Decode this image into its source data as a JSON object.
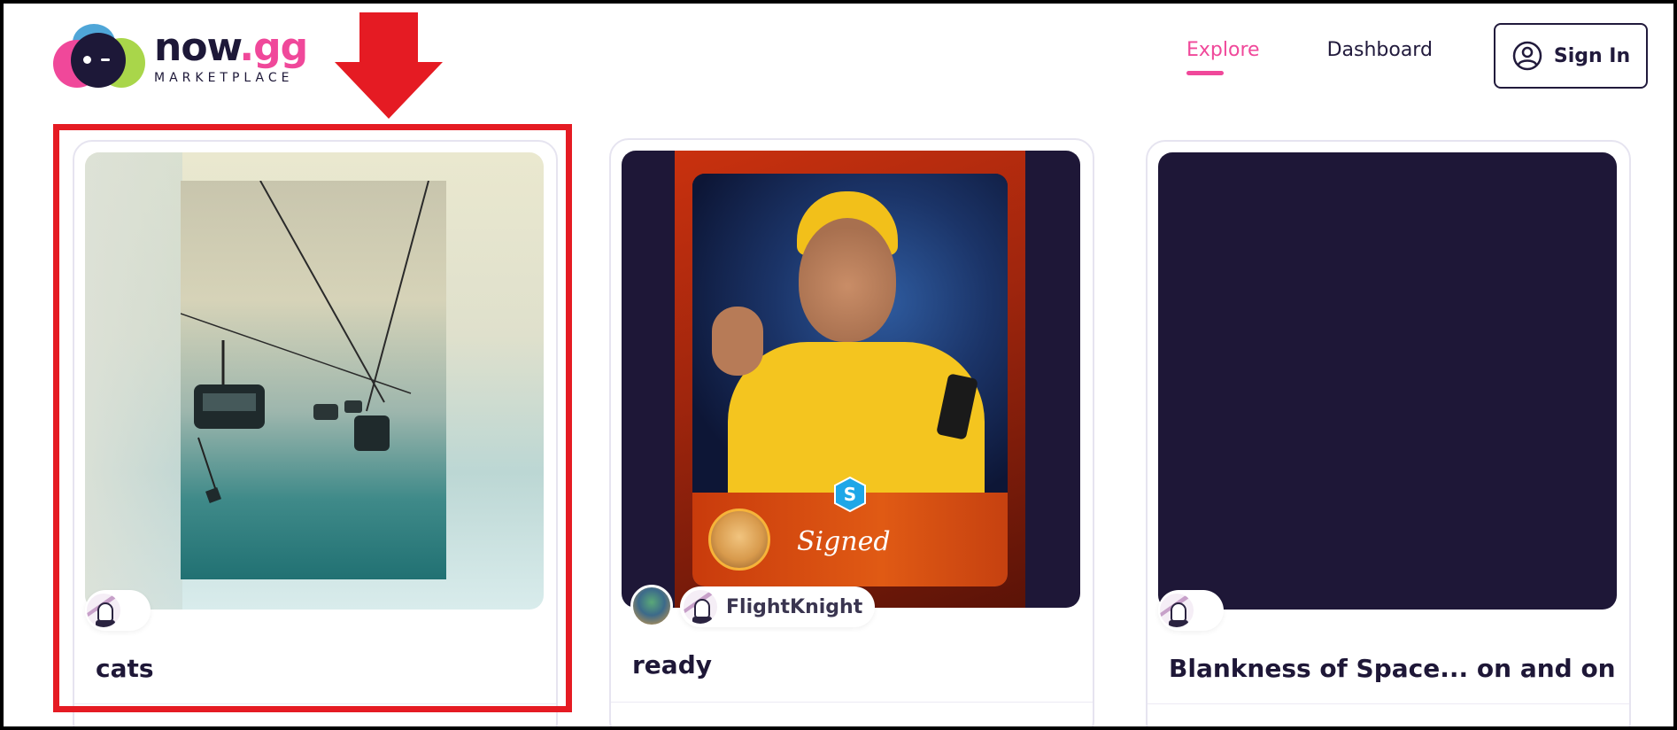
{
  "header": {
    "logo": {
      "wordmark_main": "now",
      "wordmark_accent": ".gg",
      "tagline": "MARKETPLACE"
    },
    "nav": [
      {
        "label": "Explore",
        "active": true
      },
      {
        "label": "Dashboard",
        "active": false
      }
    ],
    "sign_in_label": "Sign In"
  },
  "colors": {
    "accent": "#f0489a",
    "dark": "#1e1737",
    "highlight": "#e51b23"
  },
  "annotation": {
    "arrow": "red-down-arrow",
    "highlight": "red-rectangle-around-first-card"
  },
  "cards": [
    {
      "title": "cats",
      "creator_name": "",
      "image": "ski-lift-photo"
    },
    {
      "title": "ready",
      "creator_name": "FlightKnight",
      "image": "signed-card-excited-man",
      "signed_label": "Signed"
    },
    {
      "title": "Blankness of Space... on and on",
      "creator_name": "",
      "image": "blank-dark"
    }
  ]
}
